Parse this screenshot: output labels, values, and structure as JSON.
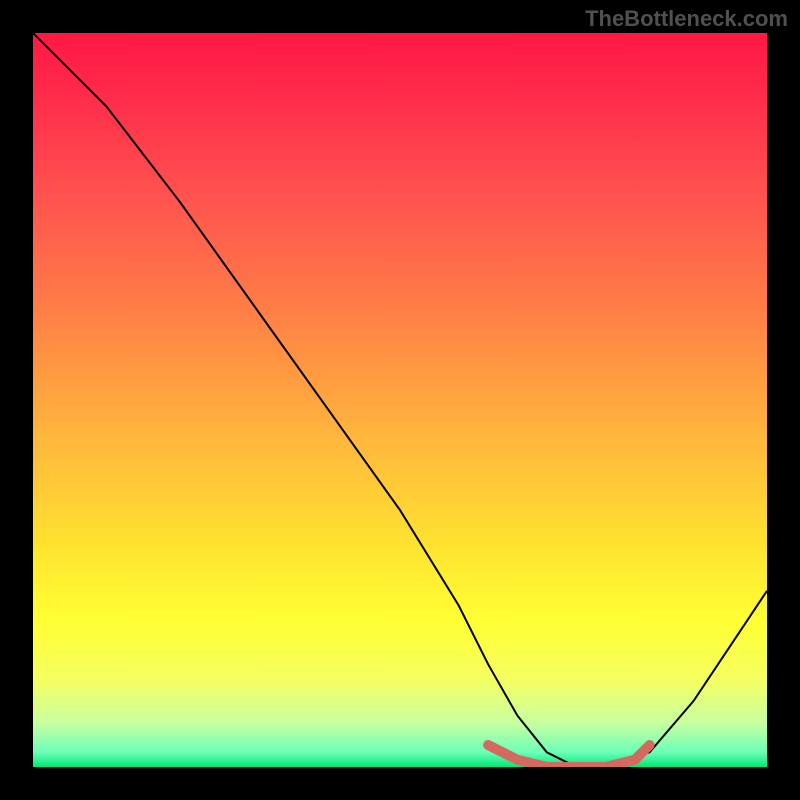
{
  "watermark": "TheBottleneck.com",
  "chart_data": {
    "type": "line",
    "title": "",
    "xlabel": "",
    "ylabel": "",
    "xlim": [
      0,
      100
    ],
    "ylim": [
      0,
      100
    ],
    "series": [
      {
        "name": "bottleneck-curve",
        "x": [
          0,
          4,
          10,
          20,
          30,
          40,
          50,
          58,
          62,
          66,
          70,
          74,
          78,
          84,
          90,
          96,
          100
        ],
        "y": [
          100,
          96,
          90,
          77,
          63,
          49,
          35,
          22,
          14,
          7,
          2,
          0,
          0,
          2,
          9,
          18,
          24
        ]
      },
      {
        "name": "optimal-range-marker",
        "x": [
          62,
          66,
          70,
          74,
          78,
          82,
          84
        ],
        "y": [
          3,
          1,
          0,
          0,
          0,
          1,
          3
        ]
      }
    ],
    "gradient_stops": [
      {
        "pos": 0,
        "color": "#ff1845"
      },
      {
        "pos": 8,
        "color": "#ff2a4a"
      },
      {
        "pos": 22,
        "color": "#ff524f"
      },
      {
        "pos": 38,
        "color": "#ff7f46"
      },
      {
        "pos": 55,
        "color": "#ffb63c"
      },
      {
        "pos": 70,
        "color": "#ffe330"
      },
      {
        "pos": 80,
        "color": "#ffff33"
      },
      {
        "pos": 88,
        "color": "#f6ff60"
      },
      {
        "pos": 94,
        "color": "#c8ffa0"
      },
      {
        "pos": 98,
        "color": "#6cffb8"
      },
      {
        "pos": 100,
        "color": "#00e878"
      }
    ]
  }
}
